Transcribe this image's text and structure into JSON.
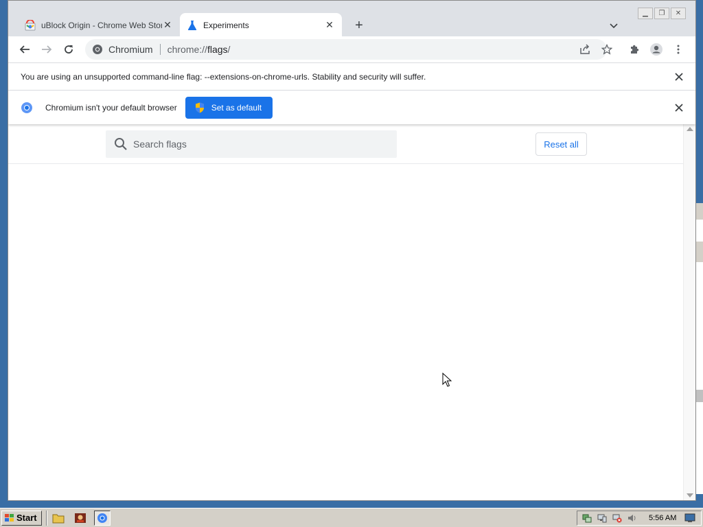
{
  "tabs": [
    {
      "title": "uBlock Origin - Chrome Web Store",
      "active": false
    },
    {
      "title": "Experiments",
      "active": true
    }
  ],
  "omnibox": {
    "chip": "Chromium",
    "url_prefix": "chrome://",
    "url_host": "flags",
    "url_suffix": "/"
  },
  "infobars": {
    "flag_warning": "You are using an unsupported command-line flag: --extensions-on-chrome-urls. Stability and security will suffer.",
    "default_browser": "Chromium isn't your default browser",
    "set_default_label": "Set as default"
  },
  "flags_page": {
    "search_placeholder": "Search flags",
    "reset_label": "Reset all"
  },
  "taskbar": {
    "start_label": "Start",
    "clock": "5:56 AM"
  },
  "colors": {
    "accent": "#1a73e8",
    "tabstrip": "#dee1e6",
    "omnibox_bg": "#f1f3f4"
  }
}
